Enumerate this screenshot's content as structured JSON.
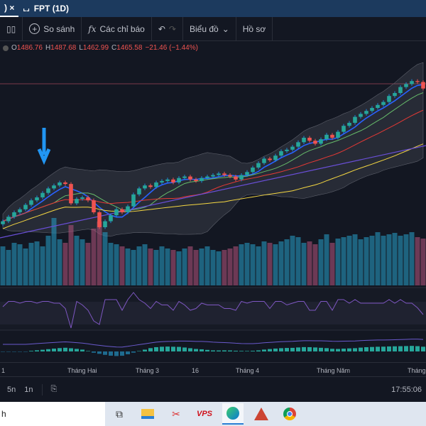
{
  "tabs": [
    {
      "label": ") ×"
    },
    {
      "label": "FPT (1D)"
    }
  ],
  "toolbar": {
    "compare": "So sánh",
    "indicators": "Các chỉ báo",
    "chart": "Biểu đồ",
    "profile": "Hồ sơ"
  },
  "legend": {
    "o_label": "O",
    "o": "1486.76",
    "h_label": "H",
    "h": "1487.68",
    "l_label": "L",
    "l": "1462.99",
    "c_label": "C",
    "c": "1465.58",
    "change": "−21.46 (−1.44%)"
  },
  "xaxis": [
    "1",
    "Tháng Hai",
    "Tháng 3",
    "16",
    "Tháng 4",
    "Tháng Năm",
    "Tháng"
  ],
  "bottom": {
    "range_5d": "5n",
    "range_1d": "1n",
    "time": "17:55:06"
  },
  "taskbar": {
    "search": "h",
    "vps": "VPS"
  },
  "colors": {
    "up": "#26a69a",
    "down": "#ef5350",
    "wick_up": "#1e88e5"
  },
  "closes": [
    1020,
    1035,
    1050,
    1060,
    1075,
    1090,
    1100,
    1115,
    1130,
    1140,
    1150,
    1145,
    1080,
    1095,
    1100,
    1090,
    1050,
    1000,
    1020,
    1040,
    1060,
    1050,
    1070,
    1110,
    1130,
    1140,
    1135,
    1150,
    1155,
    1160,
    1150,
    1165,
    1170,
    1160,
    1155,
    1165,
    1170,
    1175,
    1180,
    1175,
    1170,
    1160,
    1175,
    1185,
    1200,
    1215,
    1230,
    1225,
    1240,
    1255,
    1260,
    1270,
    1285,
    1300,
    1290,
    1280,
    1295,
    1310,
    1300,
    1320,
    1340,
    1350,
    1370,
    1380,
    1390,
    1400,
    1410,
    1420,
    1440,
    1450,
    1470,
    1480,
    1490,
    1487,
    1465
  ],
  "volumes": [
    55,
    50,
    60,
    58,
    52,
    60,
    62,
    55,
    70,
    95,
    65,
    60,
    85,
    70,
    65,
    60,
    80,
    90,
    75,
    60,
    58,
    55,
    52,
    50,
    55,
    58,
    52,
    50,
    55,
    52,
    50,
    48,
    52,
    55,
    50,
    52,
    55,
    50,
    48,
    50,
    52,
    55,
    58,
    60,
    58,
    55,
    62,
    60,
    58,
    62,
    65,
    70,
    68,
    60,
    62,
    58,
    65,
    72,
    60,
    66,
    68,
    70,
    72,
    65,
    68,
    70,
    75,
    70,
    72,
    74,
    70,
    72,
    75,
    68,
    66
  ]
}
